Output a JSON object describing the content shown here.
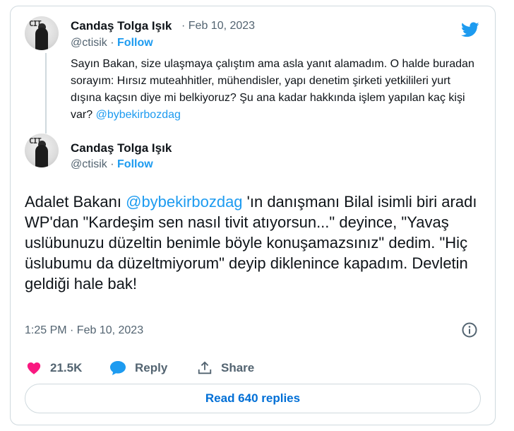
{
  "reply_tweet": {
    "author_name": "Candaş Tolga Işık",
    "date": "· Feb 10, 2023",
    "handle": "@ctisik",
    "separator": " · ",
    "follow_label": "Follow",
    "avatar_text": "CIT",
    "text_parts": [
      "Sayın Bakan, size ulaşmaya çalıştım ama asla yanıt alamadım. O halde buradan sorayım: Hırsız muteahhitler, mühendisler, yapı denetim şirketi yetkilileri yurt dışına kaçsın diye mi belkiyoruz? Şu ana kadar hakkında işlem yapılan kaç kişi var? ",
      "@bybekirbozdag"
    ]
  },
  "main_tweet": {
    "author_name": "Candaş Tolga Işık",
    "handle": "@ctisik",
    "separator": " · ",
    "follow_label": "Follow",
    "avatar_text": "CIT",
    "text_parts": [
      "Adalet Bakanı ",
      "@bybekirbozdag",
      " 'ın danışmanı Bilal isimli biri aradı WP'dan \"Kardeşim sen nasıl tivit atıyorsun...\" deyince, \"Yavaş uslübunuzu düzeltin benimle böyle konuşamazsınız\" dedim. \"Hiç üslubumu da düzeltmiyorum\" deyip diklenince kapadım. Devletin geldiği hale bak!"
    ],
    "timestamp": "1:25 PM · Feb 10, 2023"
  },
  "actions": {
    "like_count": "21.5K",
    "reply_label": "Reply",
    "share_label": "Share"
  },
  "read_replies_label": "Read 640 replies",
  "colors": {
    "accent": "#1d9bf0",
    "like": "#f91880",
    "secondary_text": "#536471",
    "border": "#cfd9de"
  },
  "icons": {
    "logo": "twitter-bird-icon",
    "info": "info-icon",
    "like": "heart-icon",
    "reply": "speech-bubble-icon",
    "share": "share-upload-icon"
  }
}
